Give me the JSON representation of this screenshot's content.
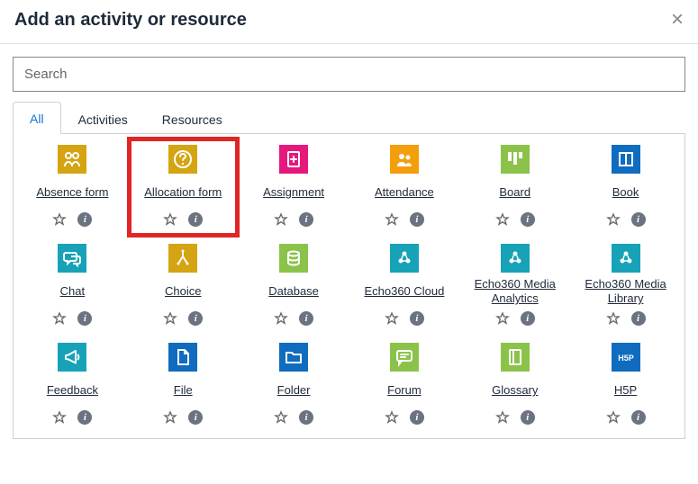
{
  "header": {
    "title": "Add an activity or resource"
  },
  "search": {
    "placeholder": "Search"
  },
  "tabs": [
    {
      "label": "All",
      "active": true
    },
    {
      "label": "Activities",
      "active": false
    },
    {
      "label": "Resources",
      "active": false
    }
  ],
  "icon_colors": {
    "yellow": "#d4a412",
    "magenta": "#e6177d",
    "orange": "#f59e0b",
    "green": "#8bc34a",
    "teal": "#17a2b8",
    "blue": "#0f6cbf"
  },
  "activities": [
    {
      "name": "Absence form",
      "icon": "people",
      "color": "yellow",
      "highlighted": false,
      "dataname": "absence-form"
    },
    {
      "name": "Allocation form",
      "icon": "question",
      "color": "yellow",
      "highlighted": true,
      "dataname": "allocation-form"
    },
    {
      "name": "Assignment",
      "icon": "doc-plus",
      "color": "magenta",
      "highlighted": false,
      "dataname": "assignment"
    },
    {
      "name": "Attendance",
      "icon": "people2",
      "color": "orange",
      "highlighted": false,
      "dataname": "attendance"
    },
    {
      "name": "Board",
      "icon": "board",
      "color": "green",
      "highlighted": false,
      "dataname": "board"
    },
    {
      "name": "Book",
      "icon": "book",
      "color": "blue",
      "highlighted": false,
      "dataname": "book"
    },
    {
      "name": "Chat",
      "icon": "chat",
      "color": "teal",
      "highlighted": false,
      "dataname": "chat"
    },
    {
      "name": "Choice",
      "icon": "choice",
      "color": "yellow",
      "highlighted": false,
      "dataname": "choice"
    },
    {
      "name": "Database",
      "icon": "database",
      "color": "green",
      "highlighted": false,
      "dataname": "database"
    },
    {
      "name": "Echo360 Cloud",
      "icon": "echo",
      "color": "teal",
      "highlighted": false,
      "dataname": "echo360-cloud"
    },
    {
      "name": "Echo360 Media Analytics",
      "icon": "echo",
      "color": "teal",
      "highlighted": false,
      "dataname": "echo360-media-analytics"
    },
    {
      "name": "Echo360 Media Library",
      "icon": "echo",
      "color": "teal",
      "highlighted": false,
      "dataname": "echo360-media-library"
    },
    {
      "name": "Feedback",
      "icon": "megaphone",
      "color": "teal",
      "highlighted": false,
      "dataname": "feedback"
    },
    {
      "name": "File",
      "icon": "file",
      "color": "blue",
      "highlighted": false,
      "dataname": "file"
    },
    {
      "name": "Folder",
      "icon": "folder",
      "color": "blue",
      "highlighted": false,
      "dataname": "folder"
    },
    {
      "name": "Forum",
      "icon": "forum",
      "color": "green",
      "highlighted": false,
      "dataname": "forum"
    },
    {
      "name": "Glossary",
      "icon": "glossary",
      "color": "green",
      "highlighted": false,
      "dataname": "glossary"
    },
    {
      "name": "H5P",
      "icon": "h5p",
      "color": "blue",
      "highlighted": false,
      "dataname": "h5p"
    }
  ]
}
